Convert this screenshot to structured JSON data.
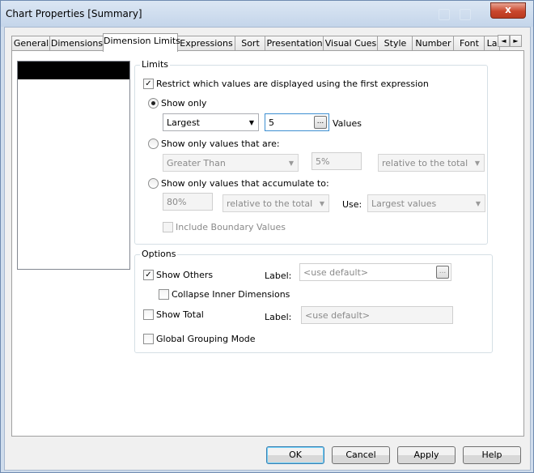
{
  "window": {
    "title": "Chart Properties [Summary]",
    "close_glyph": "x"
  },
  "tabs": [
    {
      "label": "General"
    },
    {
      "label": "Dimensions"
    },
    {
      "label": "Dimension Limits"
    },
    {
      "label": "Expressions"
    },
    {
      "label": "Sort"
    },
    {
      "label": "Presentation"
    },
    {
      "label": "Visual Cues"
    },
    {
      "label": "Style"
    },
    {
      "label": "Number"
    },
    {
      "label": "Font"
    },
    {
      "label": "La"
    }
  ],
  "tab_scroll": {
    "left": "◄",
    "right": "►"
  },
  "limits": {
    "title": "Limits",
    "restrict_label": "Restrict which values are displayed using the first expression",
    "restrict_checked": true,
    "show_only": {
      "label": "Show only",
      "selected": true,
      "mode": "Largest",
      "count": "5",
      "count_suffix": "Values"
    },
    "show_values_are": {
      "label": "Show only values that are:",
      "operator": "Greater Than",
      "percent": "5%",
      "relative": "relative to the total"
    },
    "show_accumulate": {
      "label": "Show only values that accumulate to:",
      "percent": "80%",
      "relative": "relative to the total",
      "use_label": "Use:",
      "use_value": "Largest values"
    },
    "include_boundary": {
      "label": "Include Boundary Values",
      "checked": false
    }
  },
  "options": {
    "title": "Options",
    "show_others": {
      "label": "Show Others",
      "checked": true
    },
    "others_label": {
      "label": "Label:",
      "placeholder": "<use default>"
    },
    "collapse_inner": {
      "label": "Collapse Inner Dimensions",
      "checked": false
    },
    "show_total": {
      "label": "Show Total",
      "checked": false
    },
    "total_label": {
      "label": "Label:",
      "placeholder": "<use default>"
    },
    "global_grouping": {
      "label": "Global Grouping Mode",
      "checked": false
    }
  },
  "buttons": {
    "ok": "OK",
    "cancel": "Cancel",
    "apply": "Apply",
    "help": "Help"
  },
  "icons": {
    "check": "✓",
    "dropdown": "▼",
    "ellipsis": "..."
  }
}
